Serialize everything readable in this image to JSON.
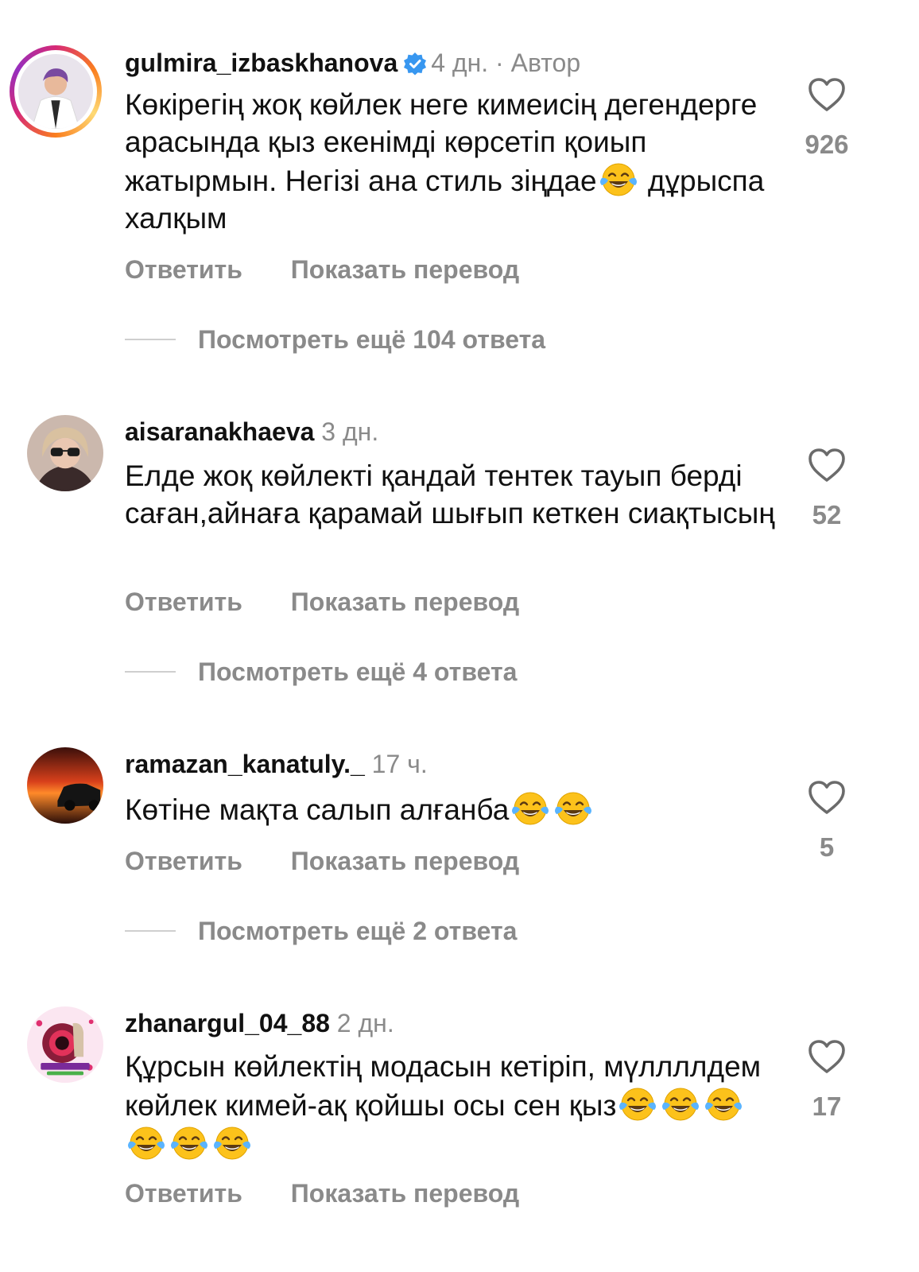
{
  "comments": [
    {
      "username": "gulmira_izbaskhanova",
      "verified": true,
      "time": "4 дн.",
      "separator": "·",
      "author_tag": "Автор",
      "text_before_emoji": "Көкірегің жоқ көйлек неге кимеисің дегендерге арасында қыз екенімді көрсетіп қоиып жатырмын. Негізі ана стиль зіңдае",
      "text_after_emoji": " дұрыспа халқым",
      "likes": "926",
      "reply_label": "Ответить",
      "translate_label": "Показать перевод",
      "more_replies": "Посмотреть ещё 104 ответа"
    },
    {
      "username": "aisaranakhaeva",
      "time": "3 дн.",
      "text": "Елде жоқ көйлекті қандай тентек тауып берді саған,айнаға қарамай шығып кеткен сиақтысың",
      "likes": "52",
      "reply_label": "Ответить",
      "translate_label": "Показать перевод",
      "more_replies": "Посмотреть ещё 4 ответа"
    },
    {
      "username": "ramazan_kanatuly._",
      "time": "17 ч.",
      "text": "Көтіне мақта салып алғанба",
      "emoji_count": 2,
      "likes": "5",
      "reply_label": "Ответить",
      "translate_label": "Показать перевод",
      "more_replies": "Посмотреть ещё 2 ответа"
    },
    {
      "username": "zhanargul_04_88",
      "time": "2 дн.",
      "text": "Құрсын көйлектің модасын кетіріп, мүллллдем көйлек кимей-ақ қойшы осы сен қыз",
      "emoji_count": 6,
      "likes": "17",
      "reply_label": "Ответить",
      "translate_label": "Показать перевод"
    }
  ],
  "icons": {
    "like": "heart-outline-icon",
    "verified": "verified-badge-icon",
    "emoji": "face-with-tears-of-joy-emoji"
  },
  "colors": {
    "text": "#111111",
    "secondary": "#8a8a8a",
    "verified_blue": "#3897f0",
    "emoji_yellow": "#fcc21b"
  }
}
